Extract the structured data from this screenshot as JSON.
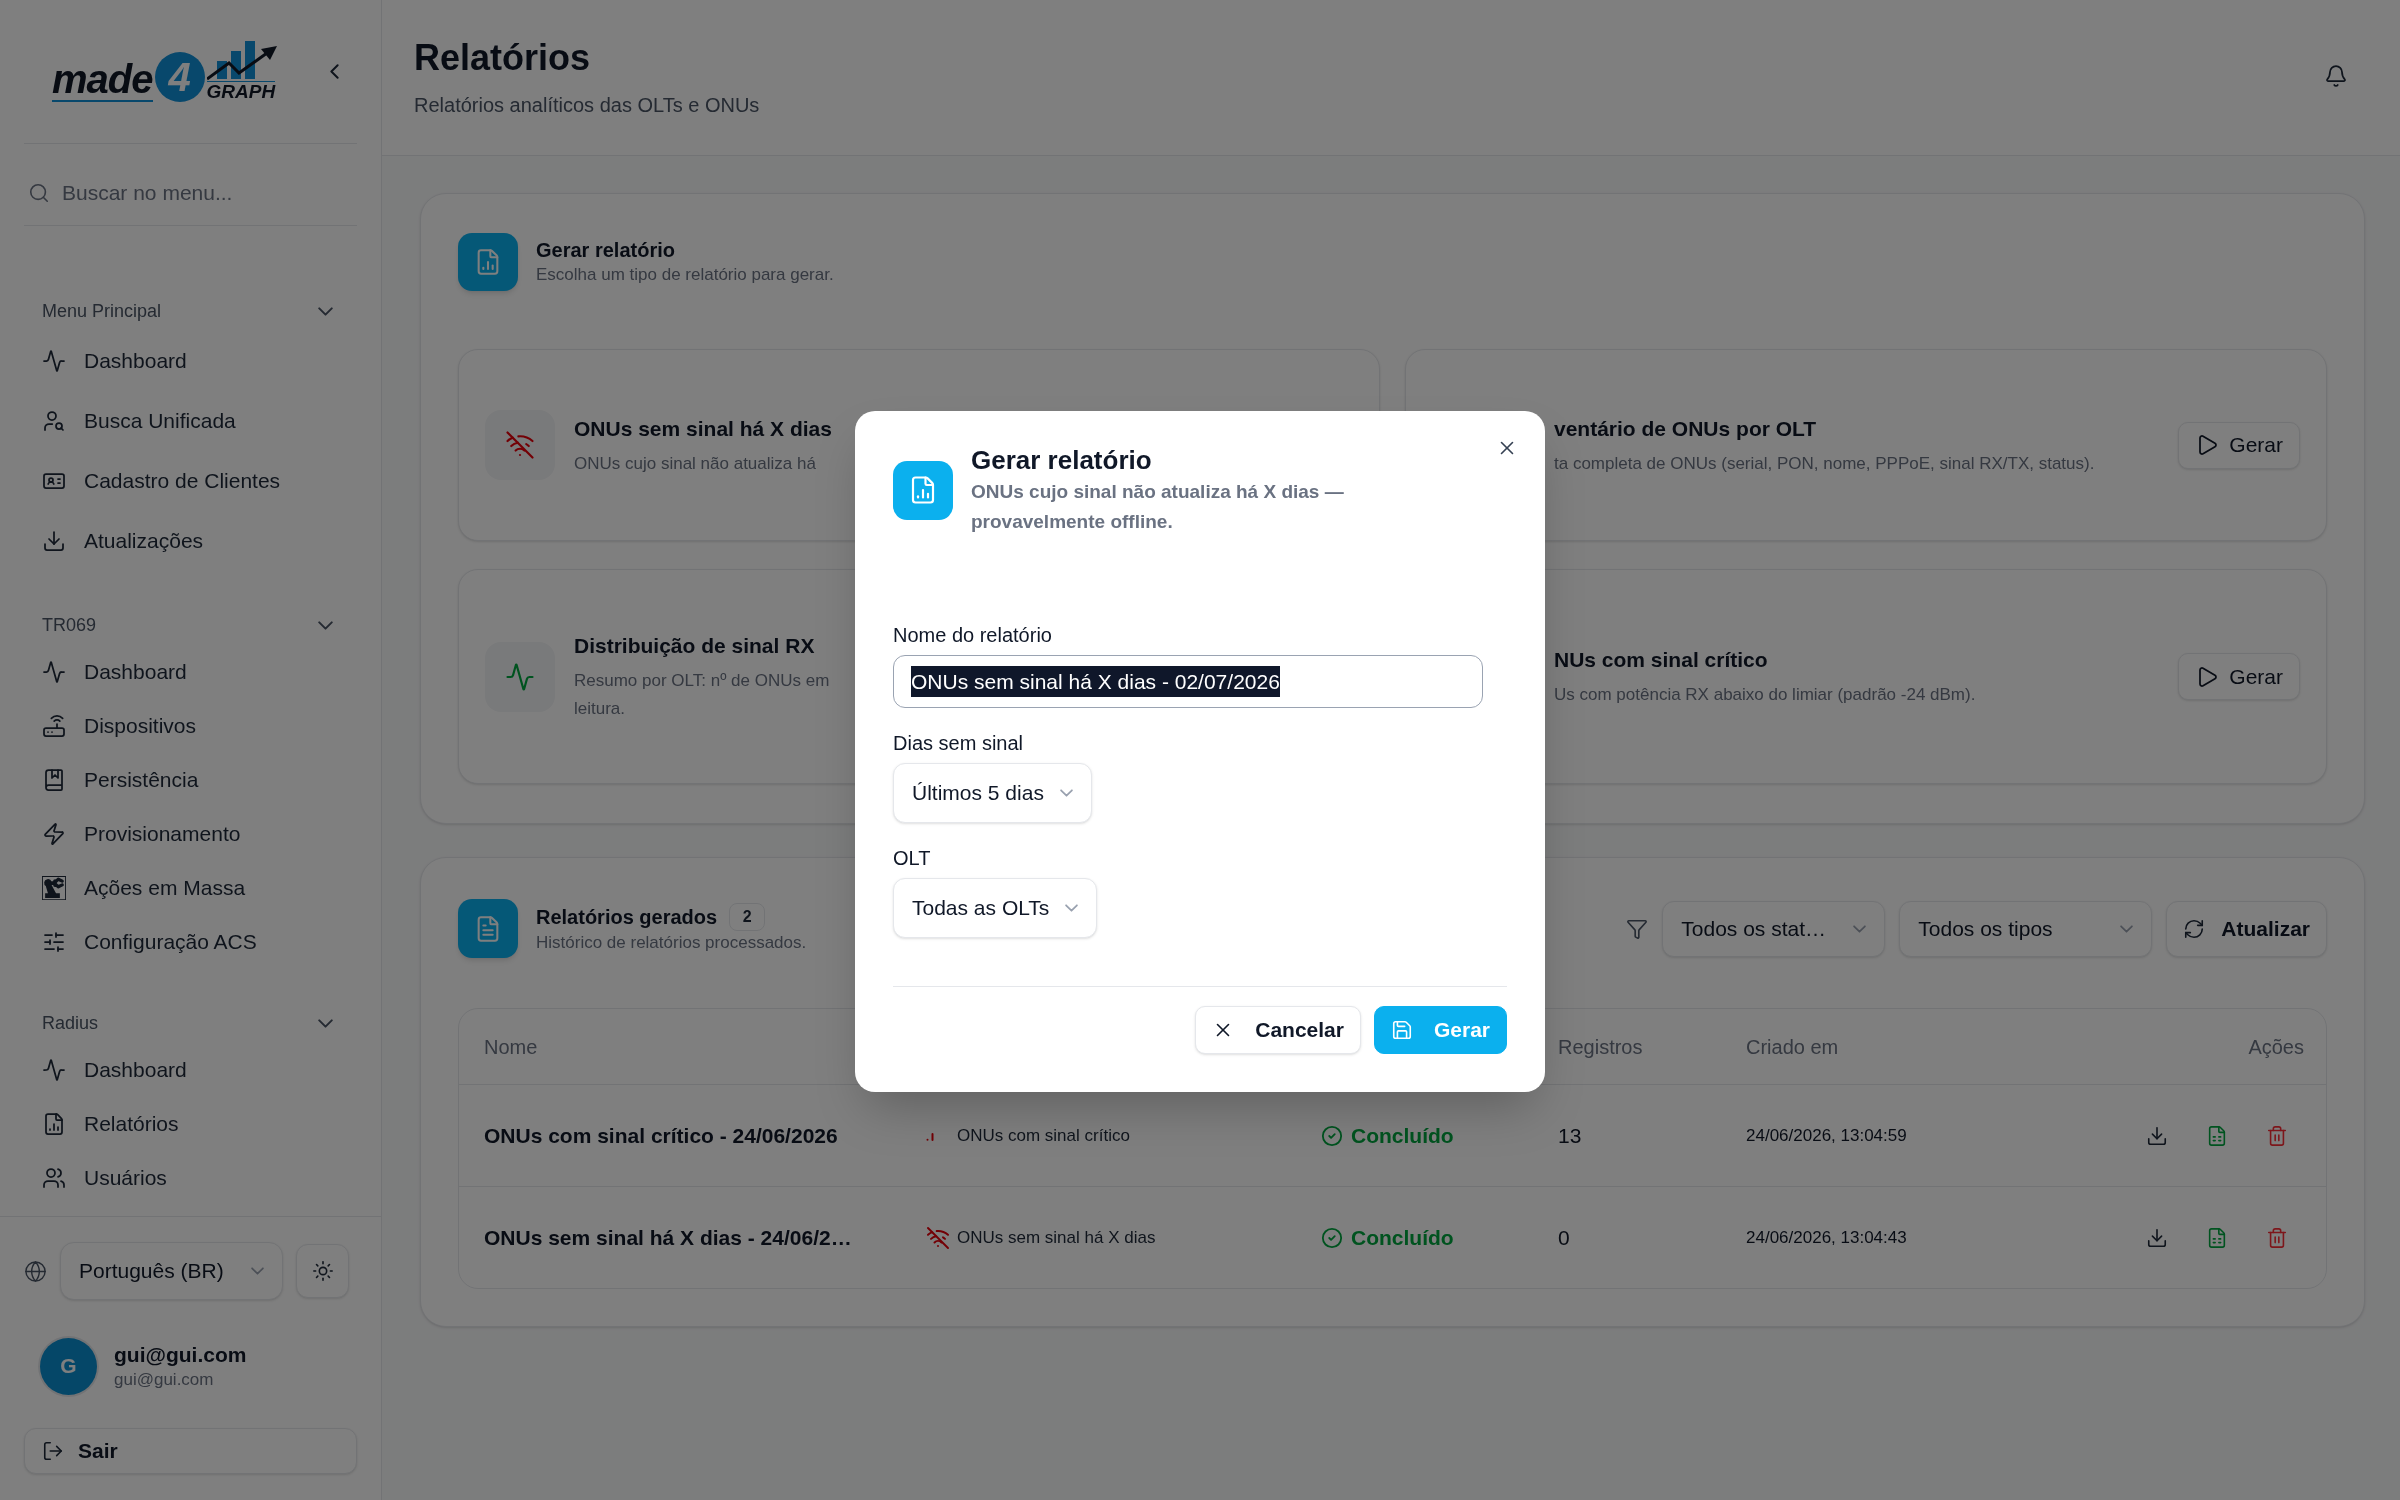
{
  "sidebar": {
    "logo": {
      "word": "made",
      "digit": "4",
      "suffix": "GRAPH"
    },
    "search": {
      "placeholder": "Buscar no menu..."
    },
    "sections": [
      {
        "title": "Menu Principal",
        "expanded": true,
        "items": [
          "Dashboard",
          "Busca Unificada",
          "Cadastro de Clientes",
          "Atualizações"
        ]
      },
      {
        "title": "TR069",
        "expanded": true,
        "items": [
          "Dashboard",
          "Dispositivos",
          "Persistência",
          "Provisionamento",
          "Ações em Massa",
          "Configuração ACS"
        ]
      },
      {
        "title": "Radius",
        "expanded": true,
        "items": [
          "Dashboard",
          "Relatórios",
          "Usuários"
        ]
      }
    ],
    "language": "Português (BR)",
    "user": {
      "initial": "G",
      "name": "gui@gui.com",
      "email": "gui@gui.com"
    },
    "logout": "Sair"
  },
  "header": {
    "title": "Relatórios",
    "subtitle": "Relatórios analíticos das OLTs e ONUs"
  },
  "generator": {
    "title": "Gerar relatório",
    "subtitle": "Escolha um tipo de relatório para gerar.",
    "report_types": [
      {
        "kind": "no_signal",
        "title": "ONUs sem sinal há X dias",
        "description_lines": [
          "ONUs cujo sinal não atualiza há"
        ]
      },
      {
        "title": "ventário de ONUs por OLT",
        "description_lines": [
          "ta completa de ONUs (serial, PON, nome, PPPoE, sinal RX/TX, status)."
        ],
        "button": "Gerar"
      },
      {
        "kind": "rx_distribution",
        "title": "Distribuição de sinal RX",
        "description_lines": [
          "Resumo por OLT: nº de ONUs em",
          "leitura."
        ]
      },
      {
        "title": "NUs com sinal crítico",
        "description_lines": [
          "Us com potência RX abaixo do limiar (padrão -24 dBm)."
        ],
        "button": "Gerar"
      }
    ]
  },
  "history": {
    "title": "Relatórios gerados",
    "count": "2",
    "subtitle": "Histórico de relatórios processados.",
    "filters": [
      {
        "value": "Todos os stat…"
      },
      {
        "value": "Todos os tipos"
      }
    ],
    "refresh_button": "Atualizar",
    "table": {
      "columns": [
        "Nome",
        "Registros",
        "Criado em",
        "Ações"
      ],
      "rows": [
        {
          "kind": "critical_signal",
          "name": "ONUs com sinal crítico - 24/06/2026",
          "type": "ONUs com sinal crítico",
          "status": "Concluído",
          "records": "13",
          "created": "24/06/2026, 13:04:59"
        },
        {
          "kind": "no_signal",
          "name": "ONUs sem sinal há X dias - 24/06/2…",
          "type": "ONUs sem sinal há X dias",
          "status": "Concluído",
          "records": "0",
          "created": "24/06/2026, 13:04:43"
        }
      ]
    }
  },
  "dialog": {
    "title": "Gerar relatório",
    "subtitle": "ONUs cujo sinal não atualiza há X dias — provavelmente offline.",
    "fields": [
      {
        "kind": "text",
        "label": "Nome do relatório",
        "value": "ONUs sem sinal há X dias - 02/07/2026",
        "value_selected": true
      },
      {
        "kind": "select",
        "label": "Dias sem sinal",
        "value": "Últimos 5 dias"
      },
      {
        "kind": "select",
        "label": "OLT",
        "value": "Todas as OLTs"
      }
    ],
    "buttons": [
      {
        "kind": "secondary",
        "label": "Cancelar"
      },
      {
        "kind": "primary",
        "label": "Gerar"
      }
    ]
  }
}
